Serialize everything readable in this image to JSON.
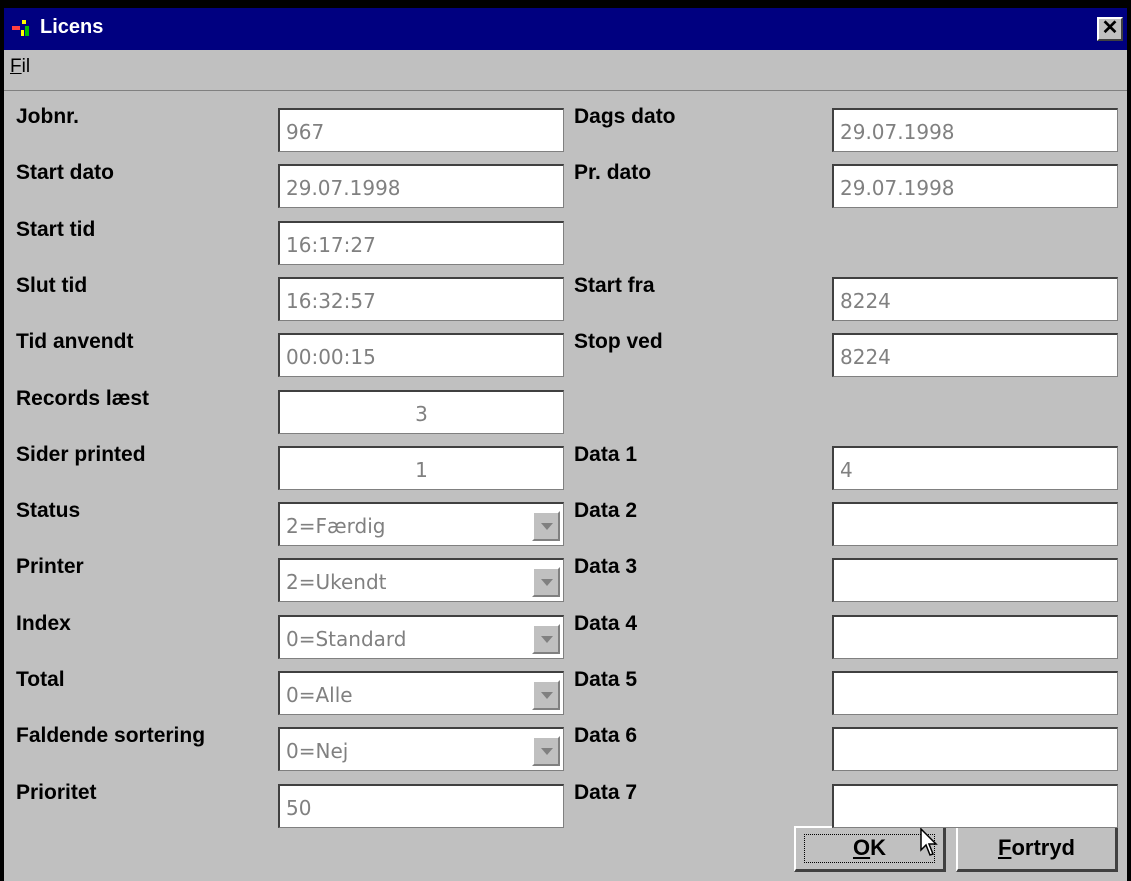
{
  "window": {
    "title": "Licens",
    "close_glyph": "✕"
  },
  "menu": {
    "items": [
      {
        "label": "Fil",
        "accel": "F",
        "rest": "il"
      }
    ]
  },
  "left": [
    {
      "label": "Jobnr.",
      "value": "967",
      "type": "text"
    },
    {
      "label": "Start dato",
      "value": "29.07.1998",
      "type": "text"
    },
    {
      "label": "Start tid",
      "value": "16:17:27",
      "type": "text"
    },
    {
      "label": "Slut tid",
      "value": "16:32:57",
      "type": "text"
    },
    {
      "label": "Tid anvendt",
      "value": "00:00:15",
      "type": "text"
    },
    {
      "label": "Records læst",
      "value": "3",
      "type": "center"
    },
    {
      "label": "Sider printed",
      "value": "1",
      "type": "center"
    },
    {
      "label": "Status",
      "value": "2=Færdig",
      "type": "combo"
    },
    {
      "label": "Printer",
      "value": "2=Ukendt",
      "type": "combo"
    },
    {
      "label": "Index",
      "value": "0=Standard",
      "type": "combo"
    },
    {
      "label": "Total",
      "value": "0=Alle",
      "type": "combo"
    },
    {
      "label": "Faldende sortering",
      "value": "0=Nej",
      "type": "combo"
    },
    {
      "label": "Prioritet",
      "value": "50",
      "type": "text"
    }
  ],
  "right": [
    {
      "label": "Dags dato",
      "value": "29.07.1998"
    },
    {
      "label": "Pr. dato",
      "value": "29.07.1998"
    },
    {
      "label": "Start fra",
      "value": "8224"
    },
    {
      "label": "Stop ved",
      "value": "8224"
    },
    {
      "label": "Data 1",
      "value": "4"
    },
    {
      "label": "Data 2",
      "value": ""
    },
    {
      "label": "Data 3",
      "value": ""
    },
    {
      "label": "Data 4",
      "value": ""
    },
    {
      "label": "Data 5",
      "value": ""
    },
    {
      "label": "Data 6",
      "value": ""
    },
    {
      "label": "Data 7",
      "value": ""
    }
  ],
  "buttons": {
    "ok": {
      "accel": "O",
      "rest": "K"
    },
    "cancel": {
      "accel": "F",
      "rest": "ortryd"
    }
  },
  "colors": {
    "titlebar": "#000080",
    "face": "#c0c0c0",
    "disabled_text": "#808080"
  }
}
